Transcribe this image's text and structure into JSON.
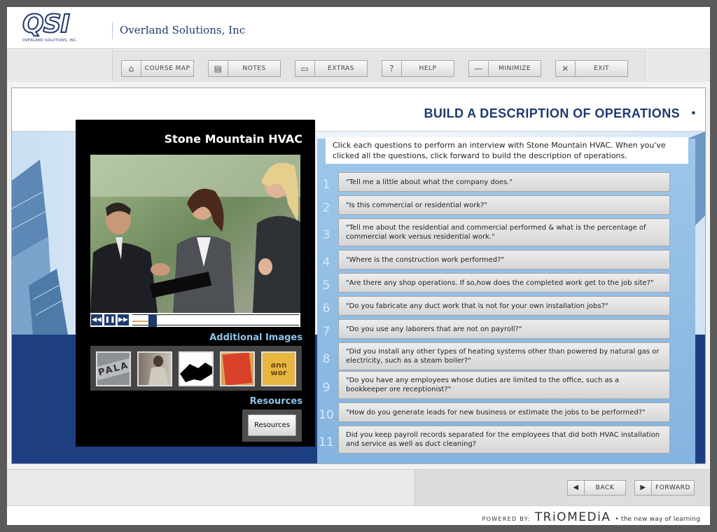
{
  "header": {
    "logo_text": "QSI",
    "logo_sub": "OVERLAND SOLUTIONS, INC.",
    "company": "Overland Solutions, Inc"
  },
  "toolbar": [
    {
      "label": "COURSE MAP",
      "icon": "home-icon",
      "glyph": "⌂"
    },
    {
      "label": "NOTES",
      "icon": "document-icon",
      "glyph": "▤"
    },
    {
      "label": "EXTRAS",
      "icon": "tray-icon",
      "glyph": "▭"
    },
    {
      "label": "HELP",
      "icon": "question-icon",
      "glyph": "?"
    },
    {
      "label": "MINIMIZE",
      "icon": "minus-icon",
      "glyph": "—"
    },
    {
      "label": "EXIT",
      "icon": "close-icon",
      "glyph": "✕"
    }
  ],
  "page": {
    "title": "BUILD A DESCRIPTION OF OPERATIONS",
    "bullet": "•"
  },
  "video": {
    "title": "Stone Mountain HVAC",
    "rewind": "◀◀",
    "pause": "❚❚",
    "forward": "▶▶",
    "progress": 0.12
  },
  "additional_images": {
    "label": "Additional Images",
    "thumb1_text": "PALA",
    "thumb5_text": "ann wor"
  },
  "resources": {
    "label": "Resources",
    "button": "Resources"
  },
  "instructions": "Click each questions to perform an interview with Stone Mountain HVAC. When you've clicked all the questions, click forward to build the description of operations.",
  "questions": [
    {
      "num": "1",
      "text": "\"Tell me a little about what the company does.\""
    },
    {
      "num": "2",
      "text": "\"Is this commercial or residential work?\""
    },
    {
      "num": "3",
      "text": "\"Tell me about the residential and commercial performed & what is the percentage of commercial work versus residential work.\""
    },
    {
      "num": "4",
      "text": "\"Where is the construction work performed?\""
    },
    {
      "num": "5",
      "text": "\"Are there any shop operations. If so,how does the completed work get to the job site?\""
    },
    {
      "num": "6",
      "text": "\"Do you fabricate any duct work that is not for your own installation  jobs?\""
    },
    {
      "num": "7",
      "text": "\"Do you use any laborers that are not on payroll?\""
    },
    {
      "num": "8",
      "text": "\"Did you install any other types of heating systems other than powered by natural gas or electricity, such as a steam boiler?\""
    },
    {
      "num": "9",
      "text": "\"Do you have any employees whose duties are limited to the office, such as a bookkeeper ore receptionist?\""
    },
    {
      "num": "10",
      "text": "\"How do you generate leads for new business or estimate the jobs to be performed?\""
    },
    {
      "num": "11",
      "text": "Did you keep payroll records separated for the employees that did both HVAC installation and service as well as duct cleaning?"
    }
  ],
  "nav": {
    "back": "BACK",
    "forward": "FORWARD",
    "back_glyph": "◀",
    "forward_glyph": "▶"
  },
  "footer": {
    "powered": "POWERED BY:",
    "brand": "TRiOMEDiA",
    "tagline": "• the new way of learning"
  },
  "colors": {
    "brand_navy": "#1f3a6e",
    "accent_light_blue": "#8fc2ea",
    "question_panel": "#9ec6ea"
  }
}
